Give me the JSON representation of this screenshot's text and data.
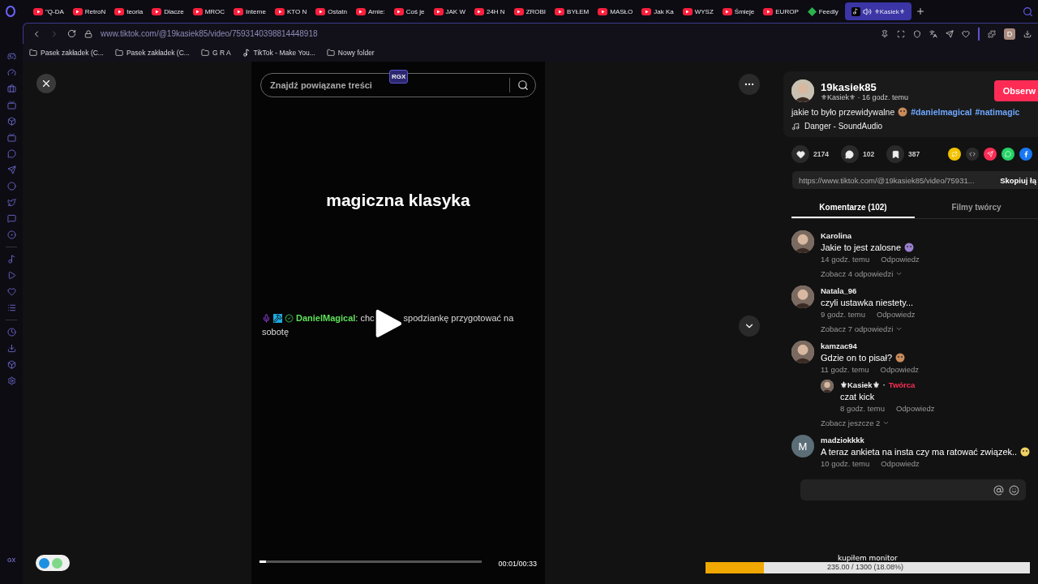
{
  "tabs": [
    {
      "kind": "youtube",
      "label": "\"Q-DA",
      "selected": false
    },
    {
      "kind": "youtube",
      "label": "RetroN",
      "selected": false
    },
    {
      "kind": "youtube",
      "label": "teoria",
      "selected": false
    },
    {
      "kind": "youtube",
      "label": "Dlacze",
      "selected": false
    },
    {
      "kind": "youtube",
      "label": "MROC",
      "selected": false
    },
    {
      "kind": "youtube",
      "label": "Interne",
      "selected": false
    },
    {
      "kind": "youtube",
      "label": "KTO N",
      "selected": false
    },
    {
      "kind": "youtube",
      "label": "Ostatn",
      "selected": false
    },
    {
      "kind": "youtube",
      "label": "Arnie:",
      "selected": false
    },
    {
      "kind": "youtube",
      "label": "Coś je",
      "selected": false
    },
    {
      "kind": "youtube",
      "label": "JAK W",
      "selected": false
    },
    {
      "kind": "youtube",
      "label": "24H N",
      "selected": false
    },
    {
      "kind": "youtube",
      "label": "ZROBI",
      "selected": false
    },
    {
      "kind": "youtube",
      "label": "BYŁEM",
      "selected": false
    },
    {
      "kind": "youtube",
      "label": "MASŁO",
      "selected": false
    },
    {
      "kind": "youtube",
      "label": "Jak Ka",
      "selected": false
    },
    {
      "kind": "youtube",
      "label": "WYSZ",
      "selected": false
    },
    {
      "kind": "youtube",
      "label": "Śmieje",
      "selected": false
    },
    {
      "kind": "youtube",
      "label": "EUROP",
      "selected": false
    },
    {
      "kind": "feedly",
      "label": "Feedly",
      "selected": false
    },
    {
      "kind": "tiktok",
      "label": "⚜Kasiek⚜",
      "selected": true
    }
  ],
  "address_bar": {
    "url": "www.tiktok.com/@19kasiek85/video/7593140398814448918"
  },
  "profile": {
    "initial": "D"
  },
  "bookmarks": [
    {
      "kind": "folder",
      "label": "Pasek zakładek (C..."
    },
    {
      "kind": "folder",
      "label": "Pasek zakładek (C..."
    },
    {
      "kind": "folder",
      "label": "G R A"
    },
    {
      "kind": "tiktok",
      "label": "TikTok - Make You..."
    },
    {
      "kind": "folder",
      "label": "Nowy folder"
    }
  ],
  "sidebar": {
    "footer": "GX"
  },
  "video": {
    "search_placeholder": "Znajdź powiązane treści",
    "badge": "RGX",
    "caption": "magiczna klasyka",
    "chat_author": "DanielMagical",
    "chat_text_before": ": chc",
    "chat_text_after": "spodziankę przygotować na",
    "chat_text_wrap": "sobotę",
    "time": "00:01/00:33",
    "level": 0.03
  },
  "post": {
    "username": "19kasiek85",
    "display_name": "⚜Kasiek⚜",
    "posted": "· 16 godz. temu",
    "follow": "Obserw",
    "description": "jakie to było przewidywalne",
    "hashtags": [
      "#danielmagical",
      "#natimagic"
    ],
    "sound": "Danger - SoundAudio",
    "likes": "2174",
    "comments": "102",
    "saves": "387",
    "share_buttons": [
      {
        "kind": "repost",
        "color": "#f2c200"
      },
      {
        "kind": "embed",
        "color": "#2b2b2b"
      },
      {
        "kind": "send",
        "color": "#fe2c55"
      },
      {
        "kind": "chat",
        "color": "#25d366"
      },
      {
        "kind": "social",
        "color": "#1877f2"
      }
    ],
    "link": "https://www.tiktok.com/@19kasiek85/video/75931...",
    "copy": "Skopiuj łą"
  },
  "panel_tabs": [
    {
      "label": "Komentarze (102)",
      "selected": true
    },
    {
      "label": "Filmy twórcy",
      "selected": false
    }
  ],
  "comments": [
    {
      "author": "Karolina",
      "text": "Jakie to jest zalosne",
      "time": "14 godz. temu",
      "reply": "Odpowiedz",
      "more": "Zobacz 4 odpowiedzi"
    },
    {
      "author": "Natala_96",
      "text": "czyli ustawka niestety...",
      "time": "9 godz. temu",
      "reply": "Odpowiedz",
      "more": "Zobacz 7 odpowiedzi"
    },
    {
      "author": "kamzac94",
      "text": "Gdzie on to pisał?",
      "time": "11 godz. temu",
      "reply": "Odpowiedz",
      "more": "Zobacz jeszcze 2",
      "children": [
        {
          "author": "⚜Kasiek⚜",
          "separator": "·",
          "badge": "Twórca",
          "text": "czat kick",
          "time": "8 godz. temu",
          "reply": "Odpowiedz"
        }
      ]
    },
    {
      "kind": "letter",
      "initial": "M",
      "author": "madziokkkk",
      "text": "A teraz ankieta na insta czy ma ratować związek..",
      "time": "10 godz. temu",
      "reply": "Odpowiedz"
    }
  ],
  "overlay": {
    "title": "kupiłem monitor",
    "goal": "235.00 / 1300 (18.08%)",
    "level": 0.18
  }
}
